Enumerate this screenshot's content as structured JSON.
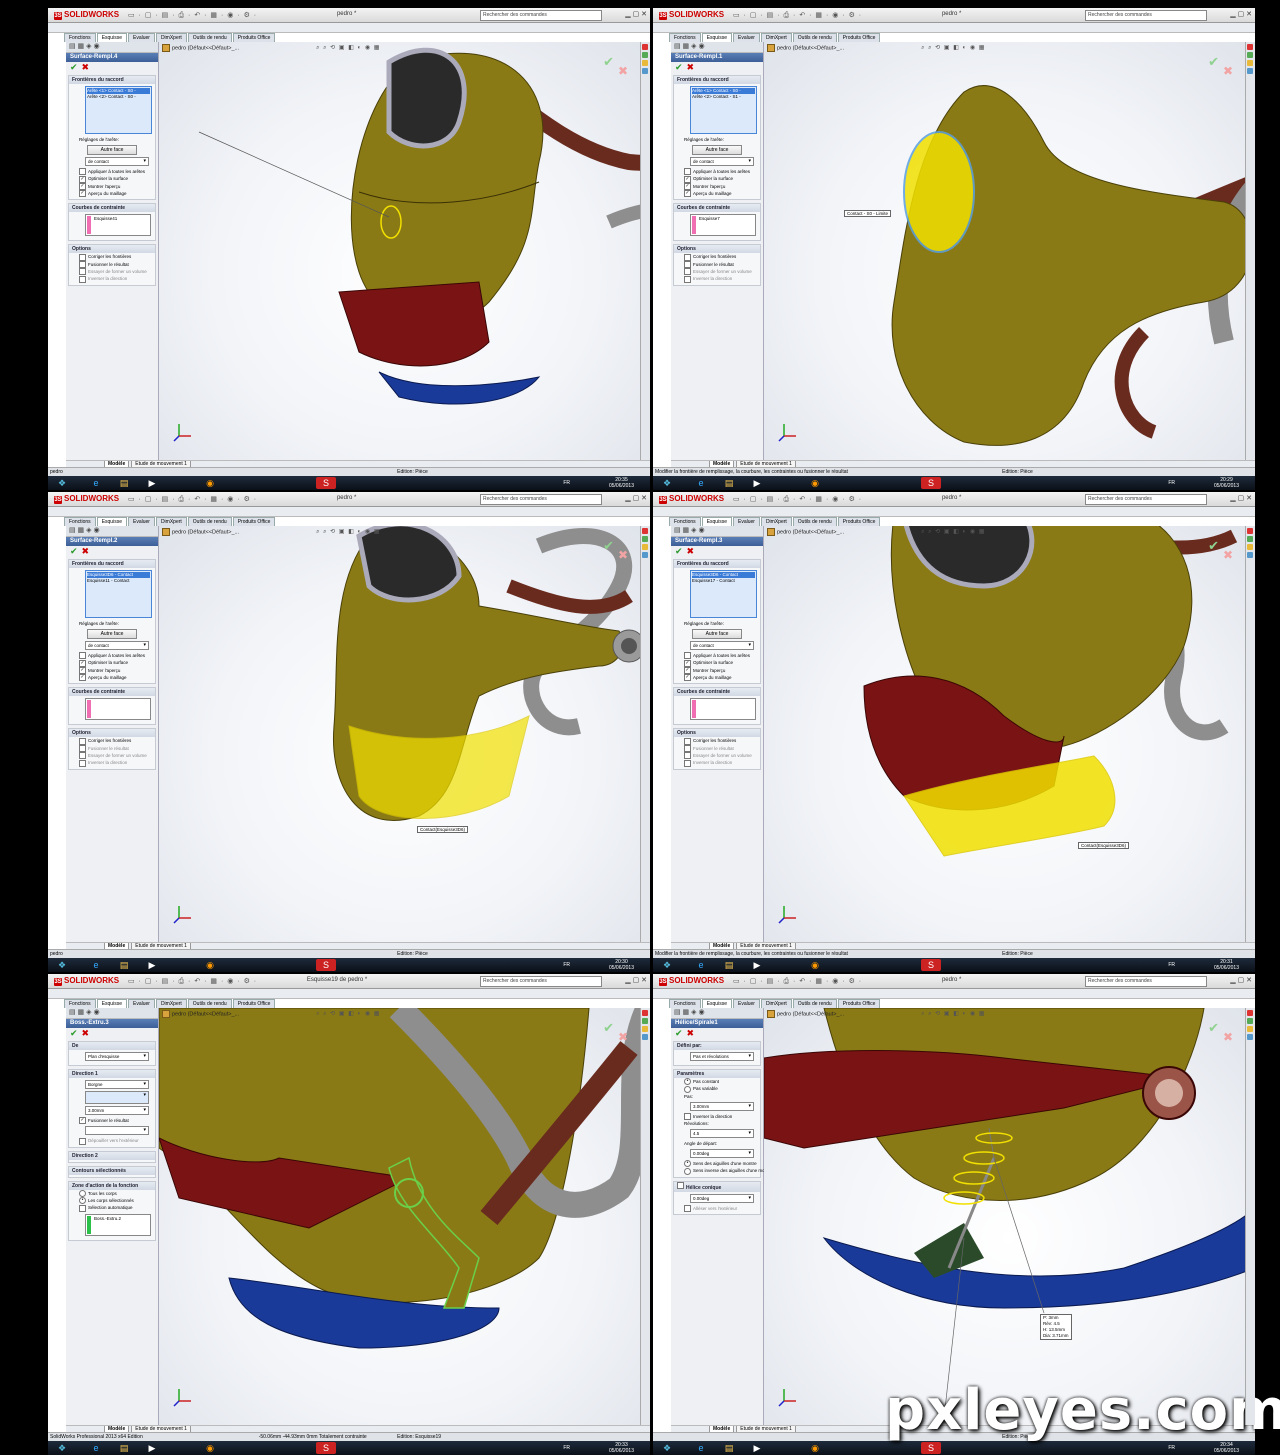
{
  "app": {
    "name": "SOLIDWORKS",
    "search_placeholder": "Rechercher des commandes"
  },
  "tree_label": "pedro  (Défaut<<Défaut>_...",
  "bottom_tabs": [
    "Modèle",
    "Etude de mouvement 1"
  ],
  "panels": [
    {
      "doc_title": "pedro *",
      "tabs": [
        "Fonctions",
        "Esquisse",
        "Evaluer",
        "DimXpert",
        "Outils de rendu",
        "Produits Office"
      ],
      "pm_title": "Surface-Rempl.4",
      "sections": {
        "bounds": "Frontières du raccord",
        "list": [
          "Arête <1> Contact - S0 -",
          "Arête <2> Contact - S0 -"
        ],
        "edge_settings": "Réglages de l'arête:",
        "alt_face": "Autre face",
        "contact": "de contact",
        "checks": [
          "Appliquer à toutes les arêtes",
          "Optimiser la surface",
          "Montrer l'aperçu",
          "Aperçu du maillage"
        ],
        "constraints": "Courbes de contrainte",
        "constraint_item": "Esquisse41",
        "options": "Options",
        "option_checks": [
          "Corriger les frontières",
          "Fusionner le résultat",
          "Essayer de former un volume",
          "Inverser la direction"
        ]
      },
      "status_left": "pedro",
      "status_right": "Edition: Pièce",
      "clock_time": "20:35",
      "clock_date": "05/06/2013",
      "callout": ""
    },
    {
      "doc_title": "pedro *",
      "tabs": [
        "Fonctions",
        "Esquisse",
        "Evaluer",
        "DimXpert",
        "Outils de rendu",
        "Produits Office"
      ],
      "pm_title": "Surface-Rempl.1",
      "sections": {
        "bounds": "Frontières du raccord",
        "list": [
          "Arête <1> Contact - S0 -",
          "Arête <2> Contact - S1 -"
        ],
        "edge_settings": "Réglages de l'arête:",
        "alt_face": "Autre face",
        "contact": "de contact",
        "checks": [
          "Appliquer à toutes les arêtes",
          "Optimiser la surface",
          "Montrer l'aperçu",
          "Aperçu du maillage"
        ],
        "constraints": "Courbes de contrainte",
        "constraint_item": "Esquisse7",
        "options": "Options",
        "option_checks": [
          "Corriger les frontières",
          "Fusionner le résultat",
          "Essayer de former un volume",
          "Inverser la direction"
        ]
      },
      "status_left": "Modifier la frontière de remplissage, la courbure, les contraintes ou fusionner le résultat",
      "status_right": "Edition: Pièce",
      "clock_time": "20:29",
      "clock_date": "05/06/2013",
      "callout": "Contact - S0 - Limite"
    },
    {
      "doc_title": "pedro *",
      "tabs": [
        "Fonctions",
        "Esquisse",
        "Evaluer",
        "DimXpert",
        "Outils de rendu",
        "Produits Office"
      ],
      "pm_title": "Surface-Rempl.2",
      "sections": {
        "bounds": "Frontières du raccord",
        "list": [
          "Esquisse3D6 - Contact",
          "Esquisse11 - Contact"
        ],
        "edge_settings": "Réglages de l'arête:",
        "alt_face": "Autre face",
        "contact": "de contact",
        "checks": [
          "Appliquer à toutes les arêtes",
          "Optimiser la surface",
          "Montrer l'aperçu",
          "Aperçu du maillage"
        ],
        "constraints": "Courbes de contrainte",
        "constraint_item": "",
        "options": "Options",
        "option_checks": [
          "Corriger les frontières",
          "Fusionner le résultat",
          "Essayer de former un volume",
          "Inverser la direction"
        ]
      },
      "status_left": "pedro",
      "status_right": "Edition: Pièce",
      "clock_time": "20:30",
      "clock_date": "05/06/2013",
      "callout": "Contact(Esquisse3D6)"
    },
    {
      "doc_title": "pedro *",
      "tabs": [
        "Fonctions",
        "Esquisse",
        "Evaluer",
        "DimXpert",
        "Outils de rendu",
        "Produits Office"
      ],
      "pm_title": "Surface-Rempl.3",
      "sections": {
        "bounds": "Frontières du raccord",
        "list": [
          "Esquisse3D6 - Contact",
          "Esquisse17 - Contact"
        ],
        "edge_settings": "Réglages de l'arête:",
        "alt_face": "Autre face",
        "contact": "de contact",
        "checks": [
          "Appliquer à toutes les arêtes",
          "Optimiser la surface",
          "Montrer l'aperçu",
          "Aperçu du maillage"
        ],
        "constraints": "Courbes de contrainte",
        "constraint_item": "",
        "options": "Options",
        "option_checks": [
          "Corriger les frontières",
          "Fusionner le résultat",
          "Essayer de former un volume",
          "Inverser la direction"
        ]
      },
      "status_left": "Modifier la frontière de remplissage, la courbure, les contraintes ou fusionner le résultat",
      "status_right": "Edition: Pièce",
      "clock_time": "20:31",
      "clock_date": "05/06/2013",
      "callout": "Contact(Esquisse3D6)"
    },
    {
      "doc_title": "Esquisse19 de pedro *",
      "tabs": [
        "Fonctions",
        "Esquisse",
        "Evaluer",
        "DimXpert",
        "Outils de rendu",
        "Produits Office"
      ],
      "pm_title": "Boss.-Extru.3",
      "extrude": {
        "from": "De",
        "from_value": "Plan d'esquisse",
        "dir1": "Direction 1",
        "end_cond": "Borgne",
        "depth": "3.00mm",
        "merge": "Fusionner le résultat",
        "draft": "Dépouiller vers l'extérieur",
        "dir2": "Direction 2",
        "contours": "Contours sélectionnés",
        "scope": "Zone d'action de la fonction",
        "scope_opts": [
          "Tous les corps",
          "Les corps sélectionnés",
          "Sélection automatique"
        ],
        "body": "Boss.-Extru.2"
      },
      "status_left": "SolidWorks Professional 2013 x64 Edition",
      "status_mid": "-50.06mm   -44.93mm   0mm   Totalement contrainte",
      "status_right": "Edition: Esquisse19",
      "clock_time": "20:33",
      "clock_date": "05/06/2013",
      "callout": ""
    },
    {
      "doc_title": "pedro *",
      "tabs": [
        "Fonctions",
        "Esquisse",
        "Evaluer",
        "DimXpert",
        "Outils de rendu",
        "Produits Office"
      ],
      "pm_title": "Hélice/Spirale1",
      "helix": {
        "defined_by": "Défini par:",
        "defined_value": "Pas et révolutions",
        "params": "Paramètres",
        "pitch_opts": [
          "Pas constant",
          "Pas variable"
        ],
        "pitch_label": "Pas:",
        "pitch": "3.00mm",
        "reverse": "Inverser la direction",
        "rev_label": "Révolutions:",
        "revs": "4.5",
        "angle_label": "Angle de départ:",
        "angle": "0.00deg",
        "dir_opts": [
          "Sens des aiguilles d'une montre",
          "Sens inverse des aiguilles d'une montre"
        ],
        "taper": "Hélice conique",
        "taper_angle": "0.00deg",
        "taper_out": "Alléser vers l'extérieur"
      },
      "readout": [
        "P: 3mm",
        "Rév: 4.5",
        "H: 13.5mm",
        "Dia: 3.71mm"
      ],
      "status_left": "",
      "status_right": "Edition: Pièce",
      "clock_time": "20:34",
      "clock_date": "05/06/2013",
      "callout": ""
    }
  ],
  "taskbar_lang": "FR",
  "watermark": "pxleyes.com"
}
